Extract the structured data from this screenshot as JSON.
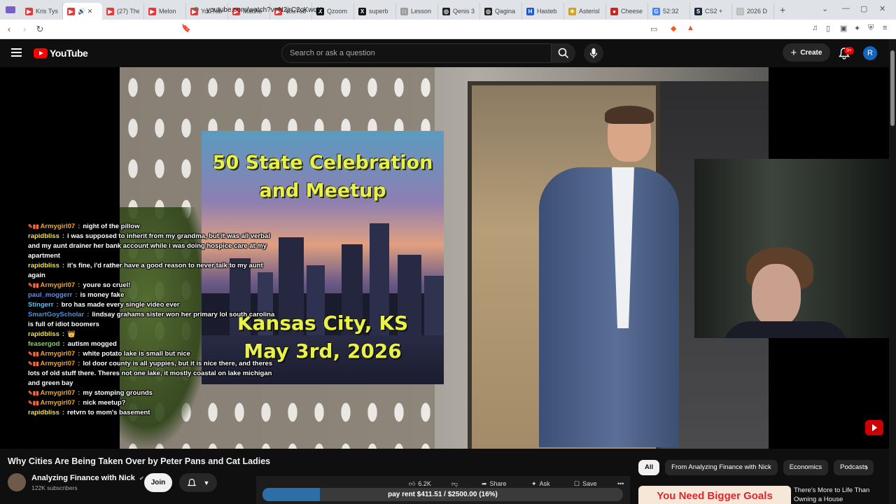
{
  "browser": {
    "tabs": [
      {
        "label": "Kris Tys",
        "color": "#e53935",
        "glyph": "▶"
      },
      {
        "label": "🔊 ✕",
        "color": "#e53935",
        "glyph": "▶",
        "active": true
      },
      {
        "label": "(27) The",
        "color": "#e53935",
        "glyph": "▶"
      },
      {
        "label": "Melon",
        "color": "#e53935",
        "glyph": "▶"
      },
      {
        "label": "YouTub",
        "color": "#e53935",
        "glyph": "▶"
      },
      {
        "label": "Matthe",
        "color": "#e53935",
        "glyph": "▶"
      },
      {
        "label": "YouTub",
        "color": "#e53935",
        "glyph": "▶"
      },
      {
        "label": "Qzoom",
        "color": "#111111",
        "glyph": "X"
      },
      {
        "label": "superb",
        "color": "#111111",
        "glyph": "X"
      },
      {
        "label": "Lesson",
        "color": "#9e9e9e",
        "glyph": "□"
      },
      {
        "label": "Qenis 3",
        "color": "#222222",
        "glyph": "◎"
      },
      {
        "label": "Qagina",
        "color": "#222222",
        "glyph": "◎"
      },
      {
        "label": "Hasteb",
        "color": "#1e57c9",
        "glyph": "H"
      },
      {
        "label": "Asterisl",
        "color": "#c9a227",
        "glyph": "✳"
      },
      {
        "label": "Cheese",
        "color": "#c62828",
        "glyph": "●"
      },
      {
        "label": "52:32",
        "color": "#4285f4",
        "glyph": "G"
      },
      {
        "label": "CS2 +",
        "color": "#1b2838",
        "glyph": "S"
      },
      {
        "label": "2026 D",
        "color": "#bdbdbd",
        "glyph": "□"
      }
    ],
    "new_tab": "+",
    "url": "youtube.com/watch?v=N2jrC2cKwqY"
  },
  "header": {
    "logo_text": "YouTube",
    "search_placeholder": "Search or ask a question",
    "create_label": "Create",
    "notif_badge": "9+",
    "avatar_letter": "R"
  },
  "video": {
    "overlay_title_line1": "50 State Celebration",
    "overlay_title_line2": "and Meetup",
    "overlay_place": "Kansas City, KS",
    "overlay_date": "May 3rd, 2026",
    "chat": [
      {
        "user": "Armygirl07",
        "badges": true,
        "color": "#f5a623",
        "text": "night of the pillow"
      },
      {
        "user": "rapidbliss",
        "badges": false,
        "color": "#f0e040",
        "text": "i was supposed to inherit from my grandma, but it was all verbal and my aunt drainer her bank account while i was doing hospice care at my apartment"
      },
      {
        "user": "rapidbliss",
        "badges": false,
        "color": "#f0e040",
        "text": "it's fine, i'd rather have a good reason to never talk to my aunt again"
      },
      {
        "user": "Armygirl07",
        "badges": true,
        "color": "#f5a623",
        "text": "youre so cruel!"
      },
      {
        "user": "paul_moggerr",
        "badges": false,
        "color": "#5b8cff",
        "text": "is money fake"
      },
      {
        "user": "Stingerr",
        "badges": false,
        "color": "#4fc3f7",
        "text": "bro has made every single video ever"
      },
      {
        "user": "SmartGoyScholar",
        "badges": false,
        "color": "#4a90e2",
        "text": "lindsay grahams sister won her primary lol south carolina is full of idiot boomers"
      },
      {
        "user": "rapidbliss",
        "badges": false,
        "color": "#f0e040",
        "text": "👑"
      },
      {
        "user": "feasergod",
        "badges": false,
        "color": "#7ed957",
        "text": "autism mogged"
      },
      {
        "user": "Armygirl07",
        "badges": true,
        "color": "#f5a623",
        "text": "white potato lake is small but nice"
      },
      {
        "user": "Armygirl07",
        "badges": true,
        "color": "#f5a623",
        "text": "lol door county is all yuppies, but it is nice there, and theres lots of old stuff there. Theres not one lake, it mostly coastal on lake michigan and green bay"
      },
      {
        "user": "Armygirl07",
        "badges": true,
        "color": "#f5a623",
        "text": "my stomping grounds"
      },
      {
        "user": "Armygirl07",
        "badges": true,
        "color": "#f5a623",
        "text": "nick meetup?"
      },
      {
        "user": "rapidbliss",
        "badges": false,
        "color": "#f0e040",
        "text": "retvrn to mom's basement"
      }
    ]
  },
  "meta": {
    "title": "Why Cities Are Being Taken Over by Peter Pans and Cat Ladies",
    "channel": "Analyzing Finance with Nick",
    "verified": "✔",
    "subs": "122K subscribers",
    "join_label": "Join",
    "likes": "6.2K",
    "share_label": "Share",
    "ask_label": "Ask",
    "save_label": "Save",
    "more_label": "•••"
  },
  "goal": {
    "label": "pay rent $411.51 / $2500.00 (16%)",
    "fraction": 0.16
  },
  "chips": [
    "All",
    "From Analyzing Finance with Nick",
    "Economics",
    "Podcasts"
  ],
  "recommendation": {
    "thumb_text": "You Need Bigger Goals",
    "title": "There's More to Life Than Owning a House"
  }
}
